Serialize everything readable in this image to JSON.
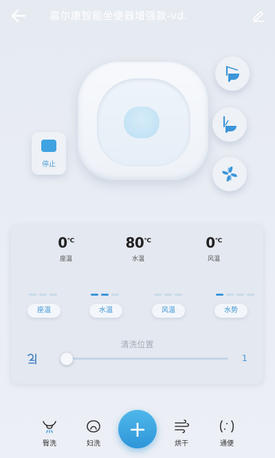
{
  "header": {
    "title": "嘉尔康智能坐便器增强款-vd.",
    "back_icon": "arrow-left-icon",
    "edit_icon": "pencil-icon"
  },
  "controls": {
    "stop_label": "停止",
    "modes": [
      {
        "name": "cover-open-mode",
        "icon": "toilet-lid-open-icon"
      },
      {
        "name": "cover-flip-mode",
        "icon": "toilet-seat-icon"
      },
      {
        "name": "fan-mode",
        "icon": "fan-icon"
      }
    ]
  },
  "panel": {
    "temps": [
      {
        "value": "0",
        "unit": "°C",
        "label": "座温"
      },
      {
        "value": "80",
        "unit": "°C",
        "label": "水温"
      },
      {
        "value": "0",
        "unit": "°C",
        "label": "风温"
      }
    ],
    "levels": [
      {
        "label": "座温",
        "level": 0,
        "max": 3
      },
      {
        "label": "水温",
        "level": 2,
        "max": 3
      },
      {
        "label": "风温",
        "level": 0,
        "max": 3
      },
      {
        "label": "水势",
        "level": 1,
        "max": 4
      }
    ],
    "wash_position": {
      "label": "清洗位置",
      "value": "1",
      "fraction": 0.0
    }
  },
  "bottom_nav": {
    "items": [
      {
        "label": "臀洗",
        "icon": "hip-wash-icon"
      },
      {
        "label": "妇洗",
        "icon": "feminine-wash-icon"
      },
      {
        "label": "烘干",
        "icon": "dry-wind-icon"
      },
      {
        "label": "通便",
        "icon": "bowel-relief-icon"
      }
    ],
    "plus_icon": "plus-icon"
  },
  "colors": {
    "accent": "#3b95d9",
    "background": "#e7ebf2",
    "panel": "#e4e8f0"
  }
}
